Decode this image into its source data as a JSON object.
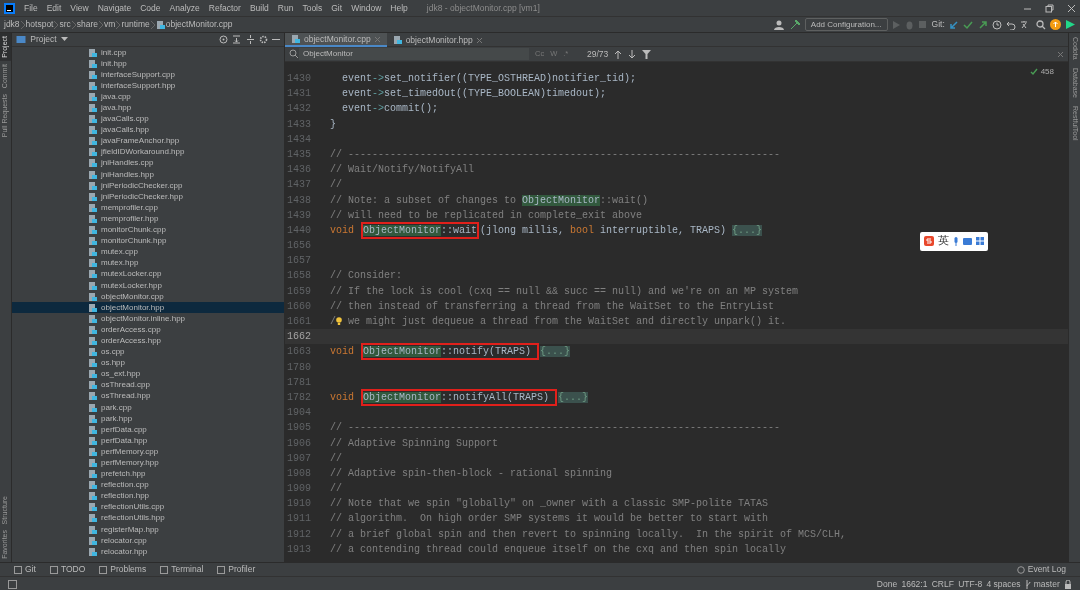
{
  "window": {
    "title": "jdk8 - objectMonitor.cpp [vm1]"
  },
  "menu": [
    "File",
    "Edit",
    "View",
    "Navigate",
    "Code",
    "Analyze",
    "Refactor",
    "Build",
    "Run",
    "Tools",
    "Git",
    "Window",
    "Help"
  ],
  "breadcrumbs": [
    "jdk8",
    "hotspot",
    "src",
    "share",
    "vm",
    "runtime",
    "objectMonitor.cpp"
  ],
  "toolbar": {
    "run_config": "Add Configuration...",
    "git_label": "Git:"
  },
  "left_strip": [
    {
      "label": "Project",
      "selected": true
    },
    {
      "label": "Commit",
      "selected": false
    },
    {
      "label": "Pull Requests",
      "selected": false
    },
    {
      "label": "Structure",
      "selected": false
    },
    {
      "label": "Favorites",
      "selected": false
    }
  ],
  "right_strip": [
    "Codota",
    "Database",
    "RestfulTool"
  ],
  "project": {
    "title": "Project",
    "files": [
      {
        "name": "init.cpp",
        "selected": false
      },
      {
        "name": "init.hpp",
        "selected": false
      },
      {
        "name": "interfaceSupport.cpp",
        "selected": false
      },
      {
        "name": "interfaceSupport.hpp",
        "selected": false
      },
      {
        "name": "java.cpp",
        "selected": false
      },
      {
        "name": "java.hpp",
        "selected": false
      },
      {
        "name": "javaCalls.cpp",
        "selected": false
      },
      {
        "name": "javaCalls.hpp",
        "selected": false
      },
      {
        "name": "javaFrameAnchor.hpp",
        "selected": false
      },
      {
        "name": "jfieldIDWorkaround.hpp",
        "selected": false
      },
      {
        "name": "jniHandles.cpp",
        "selected": false
      },
      {
        "name": "jniHandles.hpp",
        "selected": false
      },
      {
        "name": "jniPeriodicChecker.cpp",
        "selected": false
      },
      {
        "name": "jniPeriodicChecker.hpp",
        "selected": false
      },
      {
        "name": "memprofiler.cpp",
        "selected": false
      },
      {
        "name": "memprofiler.hpp",
        "selected": false
      },
      {
        "name": "monitorChunk.cpp",
        "selected": false
      },
      {
        "name": "monitorChunk.hpp",
        "selected": false
      },
      {
        "name": "mutex.cpp",
        "selected": false
      },
      {
        "name": "mutex.hpp",
        "selected": false
      },
      {
        "name": "mutexLocker.cpp",
        "selected": false
      },
      {
        "name": "mutexLocker.hpp",
        "selected": false
      },
      {
        "name": "objectMonitor.cpp",
        "selected": false
      },
      {
        "name": "objectMonitor.hpp",
        "selected": true
      },
      {
        "name": "objectMonitor.inline.hpp",
        "selected": false
      },
      {
        "name": "orderAccess.cpp",
        "selected": false
      },
      {
        "name": "orderAccess.hpp",
        "selected": false
      },
      {
        "name": "os.cpp",
        "selected": false
      },
      {
        "name": "os.hpp",
        "selected": false
      },
      {
        "name": "os_ext.hpp",
        "selected": false
      },
      {
        "name": "osThread.cpp",
        "selected": false
      },
      {
        "name": "osThread.hpp",
        "selected": false
      },
      {
        "name": "park.cpp",
        "selected": false
      },
      {
        "name": "park.hpp",
        "selected": false
      },
      {
        "name": "perfData.cpp",
        "selected": false
      },
      {
        "name": "perfData.hpp",
        "selected": false
      },
      {
        "name": "perfMemory.cpp",
        "selected": false
      },
      {
        "name": "perfMemory.hpp",
        "selected": false
      },
      {
        "name": "prefetch.hpp",
        "selected": false
      },
      {
        "name": "reflection.cpp",
        "selected": false
      },
      {
        "name": "reflection.hpp",
        "selected": false
      },
      {
        "name": "reflectionUtils.cpp",
        "selected": false
      },
      {
        "name": "reflectionUtils.hpp",
        "selected": false
      },
      {
        "name": "registerMap.hpp",
        "selected": false
      },
      {
        "name": "relocator.cpp",
        "selected": false
      },
      {
        "name": "relocator.hpp",
        "selected": false
      }
    ]
  },
  "tabs": [
    {
      "label": "objectMonitor.cpp",
      "selected": true
    },
    {
      "label": "objectMonitor.hpp",
      "selected": false
    }
  ],
  "find": {
    "value": "ObjectMonitor",
    "options": [
      "Cc",
      "W",
      ".*"
    ],
    "count": "29/73"
  },
  "inspection": {
    "count": "458"
  },
  "ime": {
    "mode": "英"
  },
  "lines": [
    {
      "number": "1430",
      "current": false,
      "segments": [
        {
          "kind": "text",
          "text": "  event"
        },
        {
          "kind": "arrow",
          "text": "->"
        },
        {
          "kind": "text",
          "text": "set_notifier((TYPE_OSTHREAD)notifier_tid);"
        }
      ]
    },
    {
      "number": "1431",
      "current": false,
      "segments": [
        {
          "kind": "text",
          "text": "  event"
        },
        {
          "kind": "arrow",
          "text": "->"
        },
        {
          "kind": "text",
          "text": "set_timedOut((TYPE_BOOLEAN)timedout);"
        }
      ]
    },
    {
      "number": "1432",
      "current": false,
      "segments": [
        {
          "kind": "text",
          "text": "  event"
        },
        {
          "kind": "arrow",
          "text": "->"
        },
        {
          "kind": "text",
          "text": "commit();"
        }
      ]
    },
    {
      "number": "1433",
      "current": false,
      "segments": [
        {
          "kind": "text",
          "text": "}"
        }
      ]
    },
    {
      "number": "1434",
      "current": false
    },
    {
      "number": "1435",
      "current": false,
      "segments": [
        {
          "kind": "comment",
          "text": "// ------------------------------------------------------------------------"
        }
      ]
    },
    {
      "number": "1436",
      "current": false,
      "segments": [
        {
          "kind": "comment",
          "text": "// Wait/Notify/NotifyAll"
        }
      ]
    },
    {
      "number": "1437",
      "current": false,
      "segments": [
        {
          "kind": "comment",
          "text": "//"
        }
      ]
    },
    {
      "number": "1438",
      "current": false,
      "segments": [
        {
          "kind": "comment",
          "text": "// Note: a subset of changes to "
        },
        {
          "kind": "match",
          "text": "ObjectMonitor"
        },
        {
          "kind": "comment",
          "text": "::wait()"
        }
      ]
    },
    {
      "number": "1439",
      "current": false,
      "segments": [
        {
          "kind": "comment",
          "text": "// will need to be replicated in complete_exit above"
        }
      ]
    },
    {
      "number": "1440",
      "current": false,
      "segments": [
        {
          "kind": "keyword",
          "text": "void "
        },
        {
          "kind": "box",
          "parts": [
            {
              "kind": "match",
              "text": "ObjectMonitor"
            },
            {
              "kind": "text",
              "text": "::wait"
            }
          ]
        },
        {
          "kind": "text",
          "text": "(jlong millis, "
        },
        {
          "kind": "keyword",
          "text": "bool"
        },
        {
          "kind": "text",
          "text": " interruptible, TRAPS) "
        },
        {
          "kind": "fold",
          "text": "{...}"
        }
      ]
    },
    {
      "number": "1656",
      "current": false
    },
    {
      "number": "1657",
      "current": false
    },
    {
      "number": "1658",
      "current": false,
      "segments": [
        {
          "kind": "comment",
          "text": "// Consider:"
        }
      ]
    },
    {
      "number": "1659",
      "current": false,
      "segments": [
        {
          "kind": "comment",
          "text": "// If the lock is cool (cxq == null && succ == null) and we're on an MP system"
        }
      ]
    },
    {
      "number": "1660",
      "current": false,
      "segments": [
        {
          "kind": "comment",
          "text": "// then instead of transferring a thread from the WaitSet to the EntryList"
        }
      ]
    },
    {
      "number": "1661",
      "current": false,
      "segments": [
        {
          "kind": "comment",
          "text": "/"
        },
        {
          "kind": "bulb"
        },
        {
          "kind": "comment",
          "text": " we might just dequeue a thread from the WaitSet and directly unpark() it."
        }
      ]
    },
    {
      "number": "1662",
      "current": true
    },
    {
      "number": "1663",
      "current": false,
      "segments": [
        {
          "kind": "keyword",
          "text": "void "
        },
        {
          "kind": "box",
          "parts": [
            {
              "kind": "match",
              "text": "ObjectMonitor"
            },
            {
              "kind": "text",
              "text": "::notify(TRAPS) "
            }
          ]
        },
        {
          "kind": "fold",
          "text": "{...}"
        }
      ]
    },
    {
      "number": "1780",
      "current": false
    },
    {
      "number": "1781",
      "current": false
    },
    {
      "number": "1782",
      "current": false,
      "segments": [
        {
          "kind": "keyword",
          "text": "void "
        },
        {
          "kind": "box",
          "parts": [
            {
              "kind": "match",
              "text": "ObjectMonitor"
            },
            {
              "kind": "text",
              "text": "::notifyAll(TRAPS) "
            }
          ]
        },
        {
          "kind": "fold",
          "text": "{...}"
        }
      ]
    },
    {
      "number": "1904",
      "current": false
    },
    {
      "number": "1905",
      "current": false,
      "segments": [
        {
          "kind": "comment",
          "text": "// ------------------------------------------------------------------------"
        }
      ]
    },
    {
      "number": "1906",
      "current": false,
      "segments": [
        {
          "kind": "comment",
          "text": "// Adaptive Spinning Support"
        }
      ]
    },
    {
      "number": "1907",
      "current": false,
      "segments": [
        {
          "kind": "comment",
          "text": "//"
        }
      ]
    },
    {
      "number": "1908",
      "current": false,
      "segments": [
        {
          "kind": "comment",
          "text": "// Adaptive spin-then-block - rational spinning"
        }
      ]
    },
    {
      "number": "1909",
      "current": false,
      "segments": [
        {
          "kind": "comment",
          "text": "//"
        }
      ]
    },
    {
      "number": "1910",
      "current": false,
      "segments": [
        {
          "kind": "comment",
          "text": "// Note that we spin \"globally\" on _owner with a classic SMP-polite TATAS"
        }
      ]
    },
    {
      "number": "1911",
      "current": false,
      "segments": [
        {
          "kind": "comment",
          "text": "// algorithm.  On high order SMP systems it would be better to start with"
        }
      ]
    },
    {
      "number": "1912",
      "current": false,
      "segments": [
        {
          "kind": "comment",
          "text": "// a brief global spin and then revert to spinning locally.  In the spirit of MCS/CLH,"
        }
      ]
    },
    {
      "number": "1913",
      "current": false,
      "segments": [
        {
          "kind": "comment",
          "text": "// a contending thread could enqueue itself on the cxq and then spin locally"
        }
      ]
    }
  ],
  "tool_windows": [
    "Git",
    "TODO",
    "Problems",
    "Terminal",
    "Profiler"
  ],
  "event_log": "Event Log",
  "status_bar": [
    "Done",
    "1662:1",
    "CRLF",
    "UTF-8",
    "4 spaces",
    "master"
  ]
}
